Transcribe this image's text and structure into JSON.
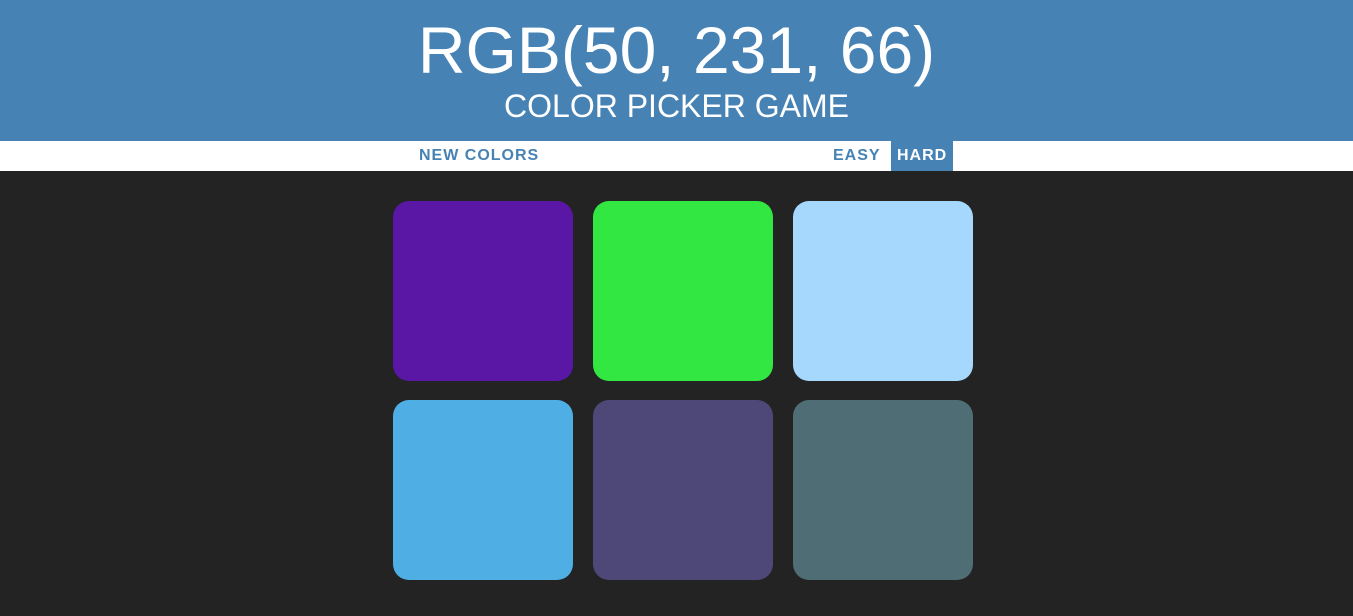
{
  "header": {
    "target_rgb": "RGB(50, 231, 66)",
    "subtitle": "COLOR PICKER GAME"
  },
  "toolbar": {
    "new_colors_label": "NEW COLORS",
    "easy_label": "EASY",
    "hard_label": "HARD",
    "selected_mode": "HARD"
  },
  "colors": {
    "header_bg": "#4682b4",
    "board_bg": "#232323"
  },
  "squares": [
    {
      "color": "#5a17a6"
    },
    {
      "color": "#32e742"
    },
    {
      "color": "#a6d8fd"
    },
    {
      "color": "#4fafe5"
    },
    {
      "color": "#4e4879"
    },
    {
      "color": "#4e6d75"
    }
  ]
}
